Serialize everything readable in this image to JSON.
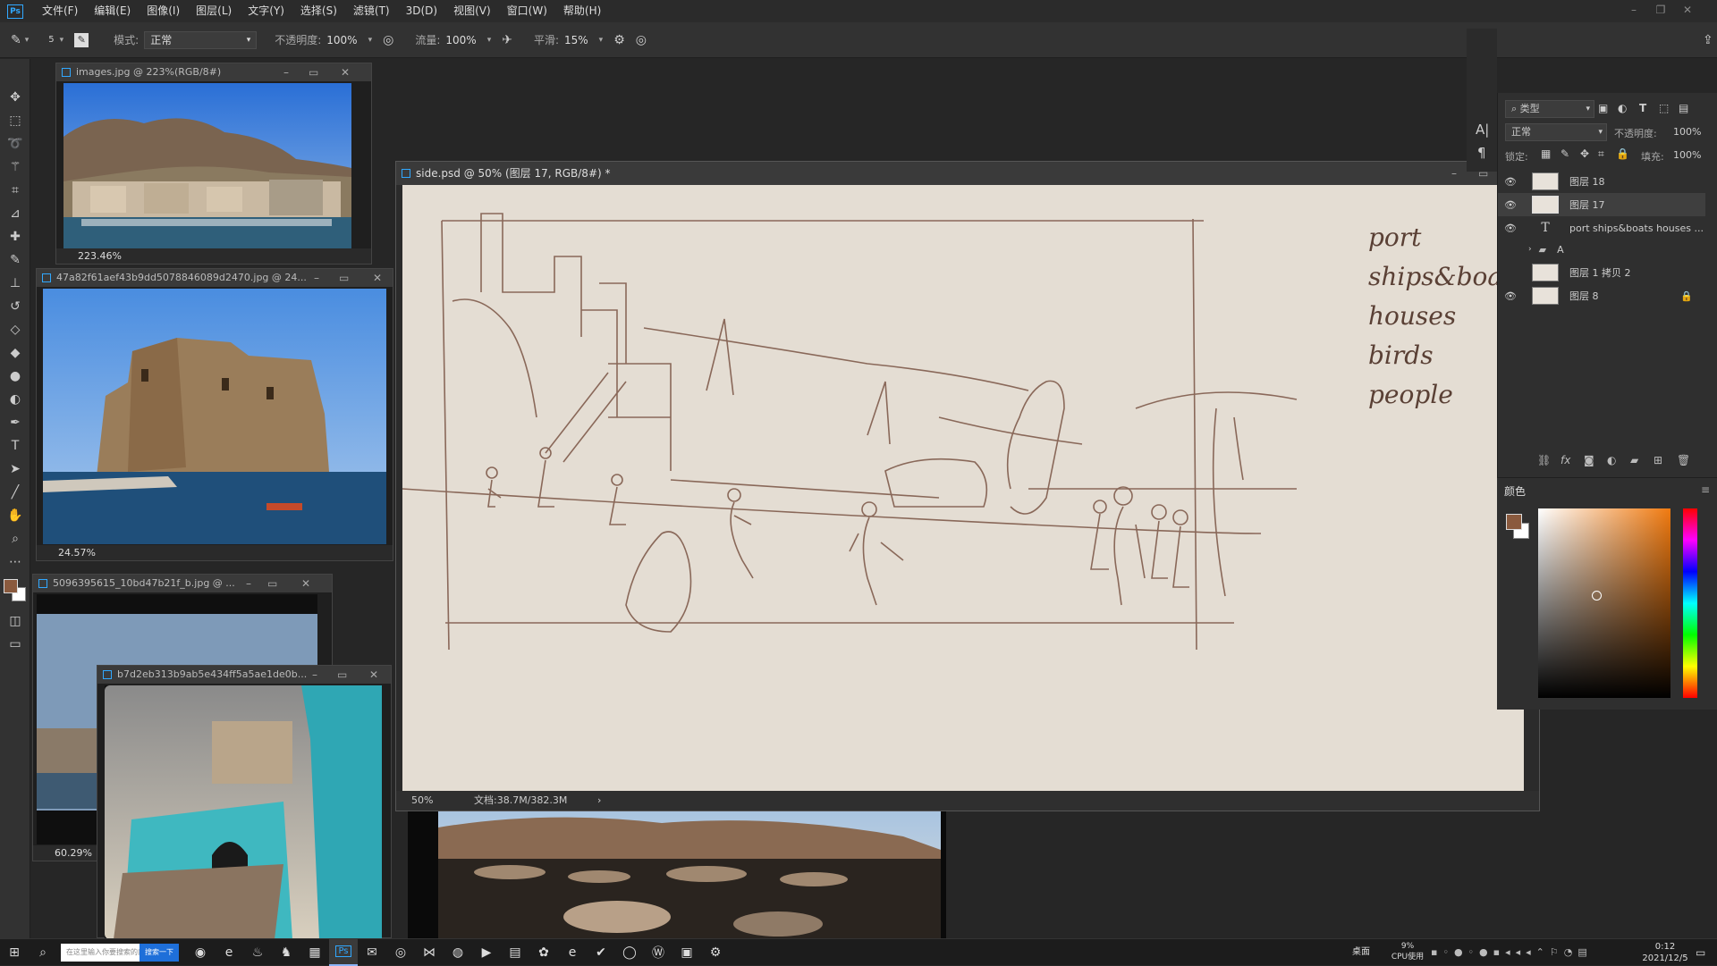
{
  "menubar": {
    "app_logo": "Ps",
    "items": [
      "文件(F)",
      "编辑(E)",
      "图像(I)",
      "图层(L)",
      "文字(Y)",
      "选择(S)",
      "滤镜(T)",
      "3D(D)",
      "视图(V)",
      "窗口(W)",
      "帮助(H)"
    ]
  },
  "options": {
    "brush_size": "5",
    "mode_label": "模式:",
    "mode_value": "正常",
    "opacity_label": "不透明度:",
    "opacity_value": "100%",
    "flow_label": "流量:",
    "flow_value": "100%",
    "smooth_label": "平滑:",
    "smooth_value": "15%"
  },
  "toolbar": {
    "tools": [
      "move-icon",
      "marquee-icon",
      "lasso-icon",
      "magic-wand-icon",
      "crop-icon",
      "eyedropper-icon",
      "healing-icon",
      "brush-icon",
      "stamp-icon",
      "history-brush-icon",
      "eraser-icon",
      "bucket-icon",
      "blur-icon",
      "dodge-icon",
      "pen-icon",
      "type-icon",
      "path-select-icon",
      "line-icon",
      "hand-icon",
      "zoom-icon",
      "more-icon"
    ],
    "fg_color": "#8a5a3e",
    "bg_color": "#ffffff"
  },
  "docs": [
    {
      "title": "images.jpg @ 223%(RGB/8#)",
      "zoom": "223.46%"
    },
    {
      "title": "47a82f61aef43b9dd5078846089d2470.jpg @ 24...",
      "zoom": "24.57%"
    },
    {
      "title": "5096395615_10bd47b21f_b.jpg @ ...",
      "zoom": "60.29%"
    },
    {
      "title": "b7d2eb313b9ab5e434ff5a5ae1de0b...",
      "zoom": ""
    }
  ],
  "main_doc": {
    "title": "side.psd @ 50% (图层 17, RGB/8#) *",
    "zoom": "50%",
    "doc_size": "文档:38.7M/382.3M",
    "notes": [
      "port",
      "ships&boa",
      "houses",
      "birds",
      "people"
    ]
  },
  "layers_panel": {
    "filter_label": "类型",
    "blend_mode": "正常",
    "opacity_label": "不透明度:",
    "opacity_value": "100%",
    "lock_label": "锁定:",
    "fill_label": "填充:",
    "fill_value": "100%",
    "layers": [
      {
        "name": "图层 18",
        "visible": true,
        "kind": "pixel",
        "selected": false
      },
      {
        "name": "图层 17",
        "visible": true,
        "kind": "pixel",
        "selected": true
      },
      {
        "name": "port ships&boats houses ...",
        "visible": true,
        "kind": "text",
        "selected": false
      },
      {
        "name": "A",
        "visible": false,
        "kind": "group",
        "selected": false
      },
      {
        "name": "图层 1 拷贝 2",
        "visible": false,
        "kind": "pixel",
        "selected": false
      },
      {
        "name": "图层 8",
        "visible": true,
        "kind": "pixel",
        "selected": false,
        "locked": true
      }
    ]
  },
  "color_panel": {
    "title": "颜色",
    "hue_color": "#f07a10"
  },
  "taskbar": {
    "search_placeholder": "在这里输入你要搜索的内容",
    "search_button": "搜索一下",
    "desktop_label": "桌面",
    "cpu_label": "CPU使用",
    "cpu_value": "9%",
    "time": "0:12",
    "date": "2021/12/5"
  }
}
